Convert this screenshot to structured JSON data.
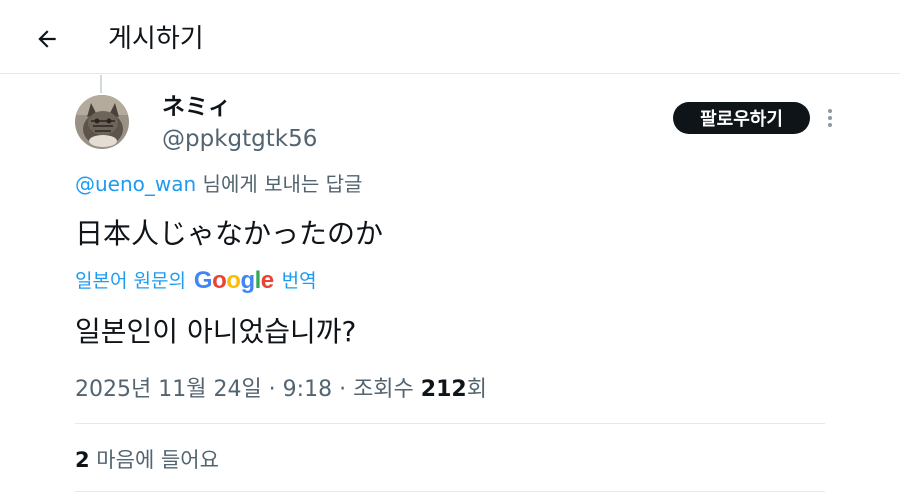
{
  "header": {
    "back_icon": "arrow-left-icon",
    "title": "게시하기"
  },
  "post": {
    "author": {
      "display_name": "ネミィ",
      "handle": "@ppkgtgtk56",
      "avatar_icon": "cat-avatar"
    },
    "follow_label": "팔로우하기",
    "more_icon": "more-vertical-icon",
    "reply_to": {
      "mention": "@ueno_wan",
      "suffix": " 님에게 보내는 답글"
    },
    "text": "日本人じゃなかったのか",
    "translation": {
      "prefix": "일본어 원문의",
      "logo_text": "Google",
      "suffix": "번역",
      "text": "일본인이 아니었습니까?"
    },
    "meta": {
      "date": "2025년 11월 24일",
      "sep1": " · ",
      "time": "9:18",
      "sep2": " · ",
      "views_label": "조회수 ",
      "views_count": "212",
      "views_suffix": "회"
    },
    "likes": {
      "count": "2",
      "label": " 마음에 들어요"
    }
  },
  "colors": {
    "link": "#1d9bf0",
    "text": "#0f1419",
    "secondary": "#536471",
    "button_bg": "#0f1419",
    "google_blue": "#4285F4",
    "google_red": "#EA4335",
    "google_yellow": "#FBBC05",
    "google_green": "#34A853"
  }
}
